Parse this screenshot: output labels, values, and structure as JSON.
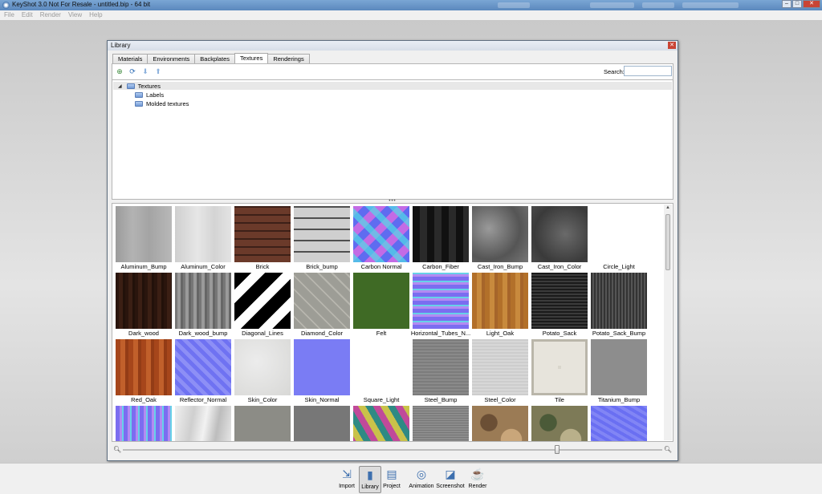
{
  "window": {
    "title": "KeyShot 3.0 Not For Resale  - untitled.bip  - 64 bit"
  },
  "menu": [
    "File",
    "Edit",
    "Render",
    "View",
    "Help"
  ],
  "library": {
    "title": "Library",
    "tabs": [
      {
        "label": "Materials",
        "active": false
      },
      {
        "label": "Environments",
        "active": false
      },
      {
        "label": "Backplates",
        "active": false
      },
      {
        "label": "Textures",
        "active": true
      },
      {
        "label": "Renderings",
        "active": false
      }
    ],
    "search": {
      "label": "Search:",
      "value": "",
      "placeholder": ""
    },
    "tree": {
      "root": "Textures",
      "children": [
        "Labels",
        "Molded textures"
      ]
    },
    "textures": [
      {
        "name": "Aluminum_Bump",
        "style": "alu"
      },
      {
        "name": "Aluminum_Color",
        "style": "alucolor"
      },
      {
        "name": "Brick",
        "style": "brick"
      },
      {
        "name": "Brick_bump",
        "style": "brickbump"
      },
      {
        "name": "Carbon Normal",
        "style": "carbonnormal"
      },
      {
        "name": "Carbon_Fiber",
        "style": "carbonfiber"
      },
      {
        "name": "Cast_Iron_Bump",
        "style": "castiron"
      },
      {
        "name": "Cast_Iron_Color",
        "style": "castironcolor"
      },
      {
        "name": "Circle_Light",
        "style": "blank"
      },
      {
        "name": "Dark_wood",
        "style": "darkwood"
      },
      {
        "name": "Dark_wood_bump",
        "style": "darkwoodbump"
      },
      {
        "name": "Diagonal_Lines",
        "style": "diagonal"
      },
      {
        "name": "Diamond_Color",
        "style": "diamond"
      },
      {
        "name": "Felt",
        "style": "felt"
      },
      {
        "name": "Horizontal_Tubes_N...",
        "style": "htubes"
      },
      {
        "name": "Light_Oak",
        "style": "lightoak"
      },
      {
        "name": "Potato_Sack",
        "style": "sack"
      },
      {
        "name": "Potato_Sack_Bump",
        "style": "sackbump"
      },
      {
        "name": "Red_Oak",
        "style": "redoak"
      },
      {
        "name": "Reflector_Normal",
        "style": "reflector"
      },
      {
        "name": "Skin_Color",
        "style": "skin"
      },
      {
        "name": "Skin_Normal",
        "style": "skinnormal"
      },
      {
        "name": "Square_Light",
        "style": "blank"
      },
      {
        "name": "Steel_Bump",
        "style": "steelbump"
      },
      {
        "name": "Steel_Color",
        "style": "steelcolor"
      },
      {
        "name": "Tile",
        "style": "tile"
      },
      {
        "name": "Titanium_Bump",
        "style": "titanium"
      },
      {
        "name": "",
        "style": "vtubes"
      },
      {
        "name": "",
        "style": "marble"
      },
      {
        "name": "",
        "style": "grey1"
      },
      {
        "name": "",
        "style": "grey2"
      },
      {
        "name": "",
        "style": "cubes"
      },
      {
        "name": "",
        "style": "brushed"
      },
      {
        "name": "",
        "style": "camo"
      },
      {
        "name": "",
        "style": "camogreen"
      },
      {
        "name": "",
        "style": "bluenormal"
      }
    ],
    "zoom_level": 0.8
  },
  "dock": [
    {
      "label": "Import",
      "icon": "import-icon",
      "glyph": "⇲",
      "active": false
    },
    {
      "label": "Library",
      "icon": "library-icon",
      "glyph": "▮",
      "active": true
    },
    {
      "label": "Project",
      "icon": "project-icon",
      "glyph": "▤",
      "active": false
    },
    {
      "label": "Animation",
      "icon": "animation-icon",
      "glyph": "◎",
      "active": false
    },
    {
      "label": "Screenshot",
      "icon": "screenshot-icon",
      "glyph": "◪",
      "active": false
    },
    {
      "label": "Render",
      "icon": "render-icon",
      "glyph": "☕",
      "active": false
    }
  ]
}
